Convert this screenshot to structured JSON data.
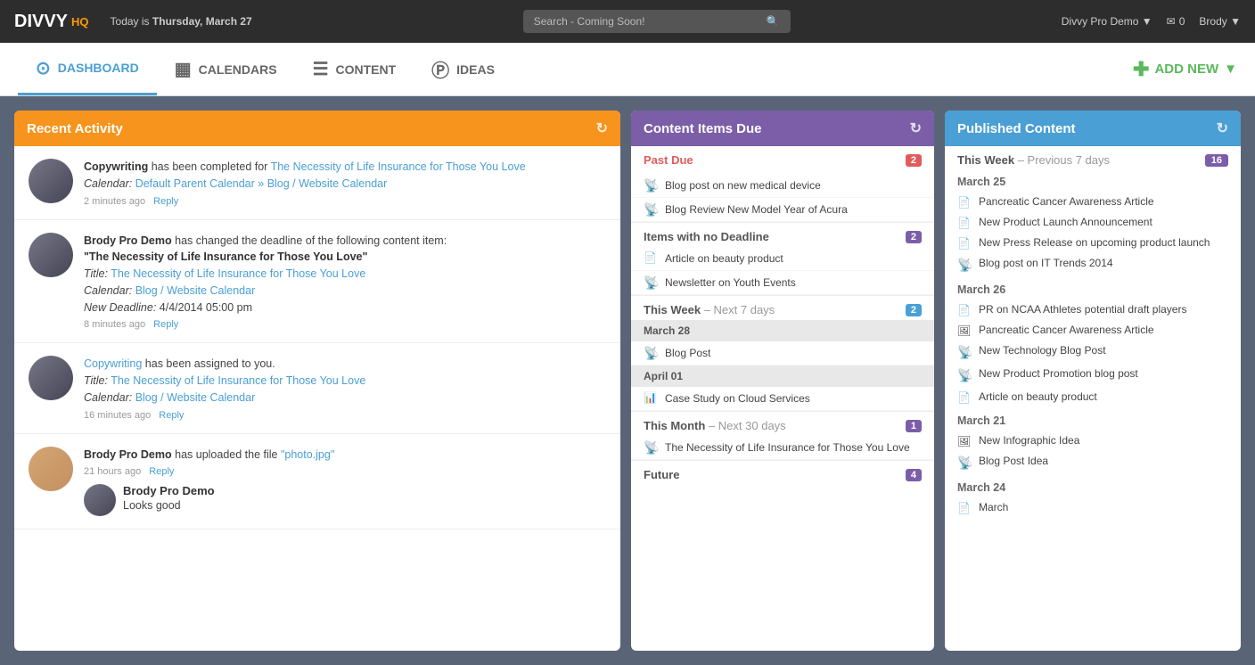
{
  "topbar": {
    "logo": "DIVVY",
    "logo_hq": "HQ",
    "today_label": "Today is",
    "today_date": "Thursday, March 27",
    "search_placeholder": "Search - Coming Soon!",
    "workspace": "Divvy Pro Demo",
    "mail_count": "0",
    "user": "Brody"
  },
  "navbar": {
    "dashboard_label": "DASHBOARD",
    "calendars_label": "CALENDARS",
    "content_label": "CONTENT",
    "ideas_label": "IDEAS",
    "add_new_label": "ADD NEW"
  },
  "recent_activity": {
    "header": "Recent Activity",
    "items": [
      {
        "action_start": "Copywriting",
        "action_mid": " has been completed for ",
        "link": "The Necessity of Life Insurance for Those You Love",
        "calendar_label": "Calendar:",
        "calendar_value": "Default Parent Calendar » Blog / Website Calendar",
        "time": "2 minutes ago",
        "reply": "Reply",
        "avatar_type": "group"
      },
      {
        "action_start": "Brody Pro Demo",
        "action_mid": " has changed the deadline of the following content item:",
        "quote": "\"The Necessity of Life Insurance for Those You Love\"",
        "title_label": "Title:",
        "title_link": "The Necessity of Life Insurance for Those You Love",
        "calendar_label": "Calendar:",
        "calendar_link": "Blog / Website Calendar",
        "deadline_label": "New Deadline:",
        "deadline_value": "4/4/2014 05:00 pm",
        "time": "8 minutes ago",
        "reply": "Reply",
        "avatar_type": "group"
      },
      {
        "action_start": "Copywriting",
        "action_mid": " has been assigned to you.",
        "title_label": "Title:",
        "title_link": "The Necessity of Life Insurance for Those You Love",
        "calendar_label": "Calendar:",
        "calendar_link": "Blog / Website Calendar",
        "time": "16 minutes ago",
        "reply": "Reply",
        "avatar_type": "group"
      },
      {
        "action_start": "Brody Pro Demo",
        "action_mid": " has uploaded the file ",
        "file_link": "\"photo.jpg\"",
        "time": "21 hours ago",
        "reply": "Reply",
        "avatar_type": "female",
        "comment_author": "Brody Pro Demo",
        "comment_text": "Looks good"
      }
    ]
  },
  "content_due": {
    "header": "Content Items Due",
    "past_due_label": "Past Due",
    "past_due_count": "2",
    "past_due_items": [
      {
        "icon": "rss",
        "text": "Blog post on new medical device"
      },
      {
        "icon": "rss",
        "text": "Blog Review New Model Year of Acura"
      }
    ],
    "no_deadline_label": "Items with no Deadline",
    "no_deadline_count": "2",
    "no_deadline_items": [
      {
        "icon": "page",
        "text": "Article on beauty product"
      },
      {
        "icon": "rss",
        "text": "Newsletter on Youth Events"
      }
    ],
    "this_week_label": "This Week",
    "this_week_sub": "– Next 7 days",
    "this_week_count": "2",
    "this_week_dates": [
      {
        "date": "March 28",
        "items": [
          {
            "icon": "rss",
            "text": "Blog Post"
          }
        ]
      },
      {
        "date": "April 01",
        "items": [
          {
            "icon": "bar",
            "text": "Case Study on Cloud Services"
          }
        ]
      }
    ],
    "this_month_label": "This Month",
    "this_month_sub": "– Next 30 days",
    "this_month_count": "1",
    "this_month_items": [
      {
        "icon": "rss",
        "text": "The Necessity of Life Insurance for Those You Love"
      }
    ],
    "future_label": "Future",
    "future_count": "4"
  },
  "published_content": {
    "header": "Published Content",
    "this_week_label": "This Week",
    "this_week_sub": "– Previous 7 days",
    "this_week_count": "16",
    "dates": [
      {
        "date": "March 25",
        "items": [
          {
            "icon": "page",
            "text": "Pancreatic Cancer Awareness Article"
          },
          {
            "icon": "page",
            "text": "New Product Launch Announcement"
          },
          {
            "icon": "page",
            "text": "New Press Release on upcoming product launch"
          },
          {
            "icon": "rss",
            "text": "Blog post on IT Trends 2014"
          }
        ]
      },
      {
        "date": "March 26",
        "items": [
          {
            "icon": "page",
            "text": "PR on NCAA Athletes potential draft players"
          },
          {
            "icon": "photo",
            "text": "Pancreatic Cancer Awareness Article"
          },
          {
            "icon": "rss",
            "text": "New Technology Blog Post"
          },
          {
            "icon": "rss",
            "text": "New Product Promotion blog post"
          },
          {
            "icon": "page",
            "text": "Article on beauty product"
          }
        ]
      },
      {
        "date": "March 21",
        "items": [
          {
            "icon": "photo",
            "text": "New Infographic Idea"
          },
          {
            "icon": "rss",
            "text": "Blog Post Idea"
          }
        ]
      },
      {
        "date": "March 24",
        "items": [
          {
            "icon": "page",
            "text": "March"
          }
        ]
      }
    ]
  }
}
